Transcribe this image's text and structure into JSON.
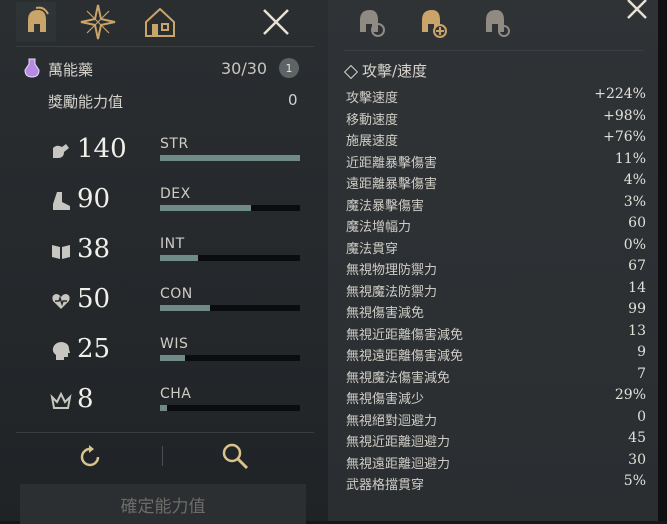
{
  "left_tabs": [
    "helmet-icon",
    "compass-star-icon",
    "house-icon",
    "close-icon"
  ],
  "potion": {
    "name": "萬能藥",
    "value": "30/30",
    "badge": "1"
  },
  "bonus": {
    "label": "獎勵能力值",
    "value": "0"
  },
  "stats": [
    {
      "value": "140",
      "label": "STR",
      "icon": "strength-arm-icon",
      "fill": 1.0
    },
    {
      "value": "90",
      "label": "DEX",
      "icon": "boot-icon",
      "fill": 0.65
    },
    {
      "value": "38",
      "label": "INT",
      "icon": "book-icon",
      "fill": 0.27
    },
    {
      "value": "50",
      "label": "CON",
      "icon": "heart-icon",
      "fill": 0.36
    },
    {
      "value": "25",
      "label": "WIS",
      "icon": "head-icon",
      "fill": 0.18
    },
    {
      "value": "8",
      "label": "CHA",
      "icon": "crown-icon",
      "fill": 0.05
    }
  ],
  "actions": {
    "reset": "reset-icon",
    "search": "magnifier-icon"
  },
  "confirm_label": "確定能力值",
  "right_tabs": [
    "helmet-gear-icon",
    "helmet-plus-icon",
    "helmet-shield-icon",
    "close-icon"
  ],
  "section_title": "攻擊/速度",
  "attributes": [
    {
      "name": "攻擊速度",
      "value": "+224%"
    },
    {
      "name": "移動速度",
      "value": "+98%"
    },
    {
      "name": "施展速度",
      "value": "+76%"
    },
    {
      "name": "近距離暴擊傷害",
      "value": "11%"
    },
    {
      "name": "遠距離暴擊傷害",
      "value": "4%"
    },
    {
      "name": "魔法暴擊傷害",
      "value": "3%"
    },
    {
      "name": "魔法增幅力",
      "value": "60"
    },
    {
      "name": "魔法貫穿",
      "value": "0%"
    },
    {
      "name": "無視物理防禦力",
      "value": "67"
    },
    {
      "name": "無視魔法防禦力",
      "value": "14"
    },
    {
      "name": "無視傷害減免",
      "value": "99"
    },
    {
      "name": "無視近距離傷害減免",
      "value": "13"
    },
    {
      "name": "無視遠距離傷害減免",
      "value": "9"
    },
    {
      "name": "無視魔法傷害減免",
      "value": "7"
    },
    {
      "name": "無視傷害減少",
      "value": "29%"
    },
    {
      "name": "無視絕對迴避力",
      "value": "0"
    },
    {
      "name": "無視近距離迴避力",
      "value": "45"
    },
    {
      "name": "無視遠距離迴避力",
      "value": "30"
    },
    {
      "name": "武器格擋貫穿",
      "value": "5%"
    }
  ]
}
